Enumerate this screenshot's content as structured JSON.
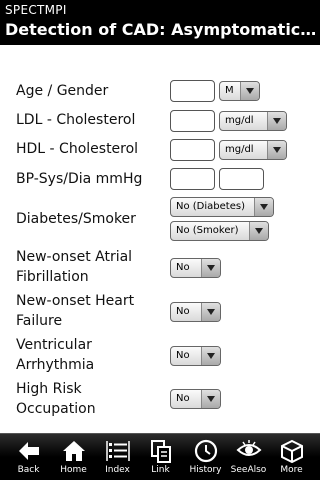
{
  "header": {
    "app_name": "SPECTMPI",
    "title": "Detection of CAD:  Asymptomatic (without known CAD)"
  },
  "form": {
    "age_gender": {
      "label": "Age / Gender",
      "gender_value": "M"
    },
    "ldl": {
      "label": "LDL - Cholesterol",
      "unit_value": "mg/dl"
    },
    "hdl": {
      "label": "HDL - Cholesterol",
      "unit_value": "mg/dl"
    },
    "bp": {
      "label": "BP-Sys/Dia mmHg"
    },
    "diabetes_smoker": {
      "label": "Diabetes/Smoker",
      "diabetes_value": "No (Diabetes)",
      "smoker_value": "No (Smoker)"
    },
    "afib": {
      "label_line1": "New-onset Atrial",
      "label_line2": "Fibrillation",
      "value": "No"
    },
    "heart_failure": {
      "label_line1": "New-onset Heart",
      "label_line2": "Failure",
      "value": "No"
    },
    "arrhythmia": {
      "label_line1": "Ventricular",
      "label_line2": "Arrhythmia",
      "value": "No"
    },
    "occupation": {
      "label_line1": "High Risk",
      "label_line2": "Occupation",
      "value": "No"
    }
  },
  "tabbar": {
    "back": "Back",
    "home": "Home",
    "index": "Index",
    "link": "Link",
    "history": "History",
    "see_also": "SeeAlso",
    "more": "More"
  }
}
